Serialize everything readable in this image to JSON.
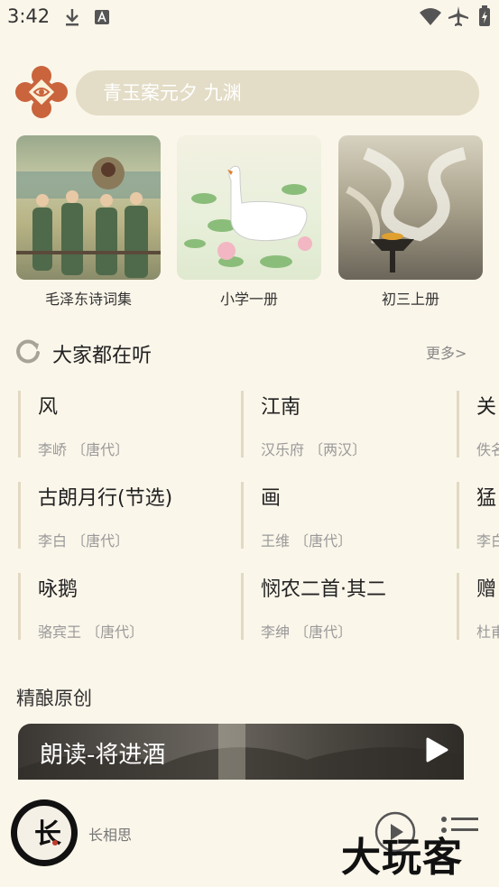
{
  "status_bar": {
    "time": "3:42"
  },
  "search": {
    "placeholder": "青玉案元夕 九渊"
  },
  "books": [
    {
      "title": "毛泽东诗词集"
    },
    {
      "title": "小学一册"
    },
    {
      "title": "初三上册"
    }
  ],
  "popular": {
    "title": "大家都在听",
    "more": "更多>",
    "poems": [
      {
        "title": "风",
        "author": "李峤 〔唐代〕"
      },
      {
        "title": "江南",
        "author": "汉乐府 〔两汉〕"
      },
      {
        "title": "关",
        "author": "佚名"
      },
      {
        "title": "古朗月行(节选)",
        "author": "李白 〔唐代〕"
      },
      {
        "title": "画",
        "author": "王维 〔唐代〕"
      },
      {
        "title": "猛",
        "author": "李白"
      },
      {
        "title": "咏鹅",
        "author": "骆宾王 〔唐代〕"
      },
      {
        "title": "悯农二首·其二",
        "author": "李绅 〔唐代〕"
      },
      {
        "title": "赠",
        "author": "杜甫"
      }
    ]
  },
  "original": {
    "title": "精酿原创",
    "banner_label": "朗读-将进酒"
  },
  "player": {
    "now_playing": "长相思",
    "avatar_text": "长"
  },
  "watermark": "大玩客"
}
